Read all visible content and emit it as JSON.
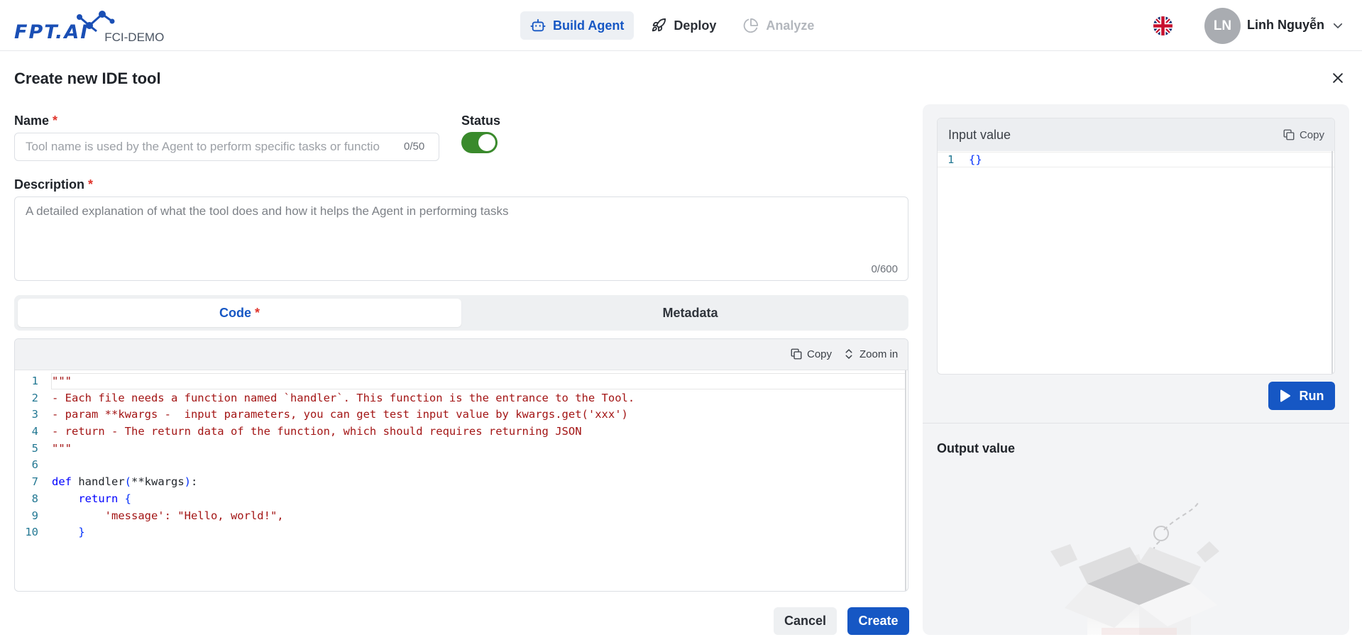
{
  "header": {
    "logo_text": "FPT.AI",
    "workspace": "FCI-DEMO",
    "nav_tabs": [
      {
        "label": "Build Agent",
        "icon": "robot-icon",
        "state": "active"
      },
      {
        "label": "Deploy",
        "icon": "rocket-icon",
        "state": "normal"
      },
      {
        "label": "Analyze",
        "icon": "pie-chart-icon",
        "state": "disabled"
      }
    ],
    "language_flag": "uk-flag-icon",
    "avatar_initials": "LN",
    "user_name": "Linh Nguyễn"
  },
  "page": {
    "title": "Create new IDE tool"
  },
  "form": {
    "name_label": "Name",
    "required_mark": "*",
    "name_value": "",
    "name_placeholder": "Tool name is used by the Agent to perform specific tasks or functions",
    "name_counter": "0/50",
    "status_label": "Status",
    "status_on": true,
    "description_label": "Description",
    "description_value": "",
    "description_placeholder": "A detailed explanation of what the tool does and how it helps the Agent in performing tasks",
    "description_counter": "0/600",
    "tabs": [
      {
        "label": "Code",
        "required": "*",
        "active": true
      },
      {
        "label": "Metadata",
        "active": false
      }
    ]
  },
  "editor": {
    "copy_label": "Copy",
    "zoom_label": "Zoom in",
    "line_numbers": [
      "1",
      "2",
      "3",
      "4",
      "5",
      "6",
      "7",
      "8",
      "9",
      "10"
    ],
    "lines": [
      "\"\"\"",
      "- Each file needs a function named `handler`. This function is the entrance to the Tool.",
      "- param **kwargs -  input parameters, you can get test input value by kwargs.get('xxx')",
      "- return - The return data of the function, which should requires returning JSON",
      "\"\"\"",
      "",
      "def handler(**kwargs):",
      "    return {",
      "        'message': \"Hello, world!\",",
      "    }"
    ]
  },
  "actions": {
    "cancel_label": "Cancel",
    "create_label": "Create"
  },
  "test_panel": {
    "input_title": "Input value",
    "input_copy_label": "Copy",
    "input_line_number": "1",
    "input_value": "{}",
    "run_label": "Run",
    "output_title": "Output value"
  },
  "colors": {
    "primary": "#1657c4",
    "toggle_on": "#3a8a2c",
    "required": "#e0342b",
    "code_string": "#a31515",
    "code_keyword": "#0000ff"
  }
}
